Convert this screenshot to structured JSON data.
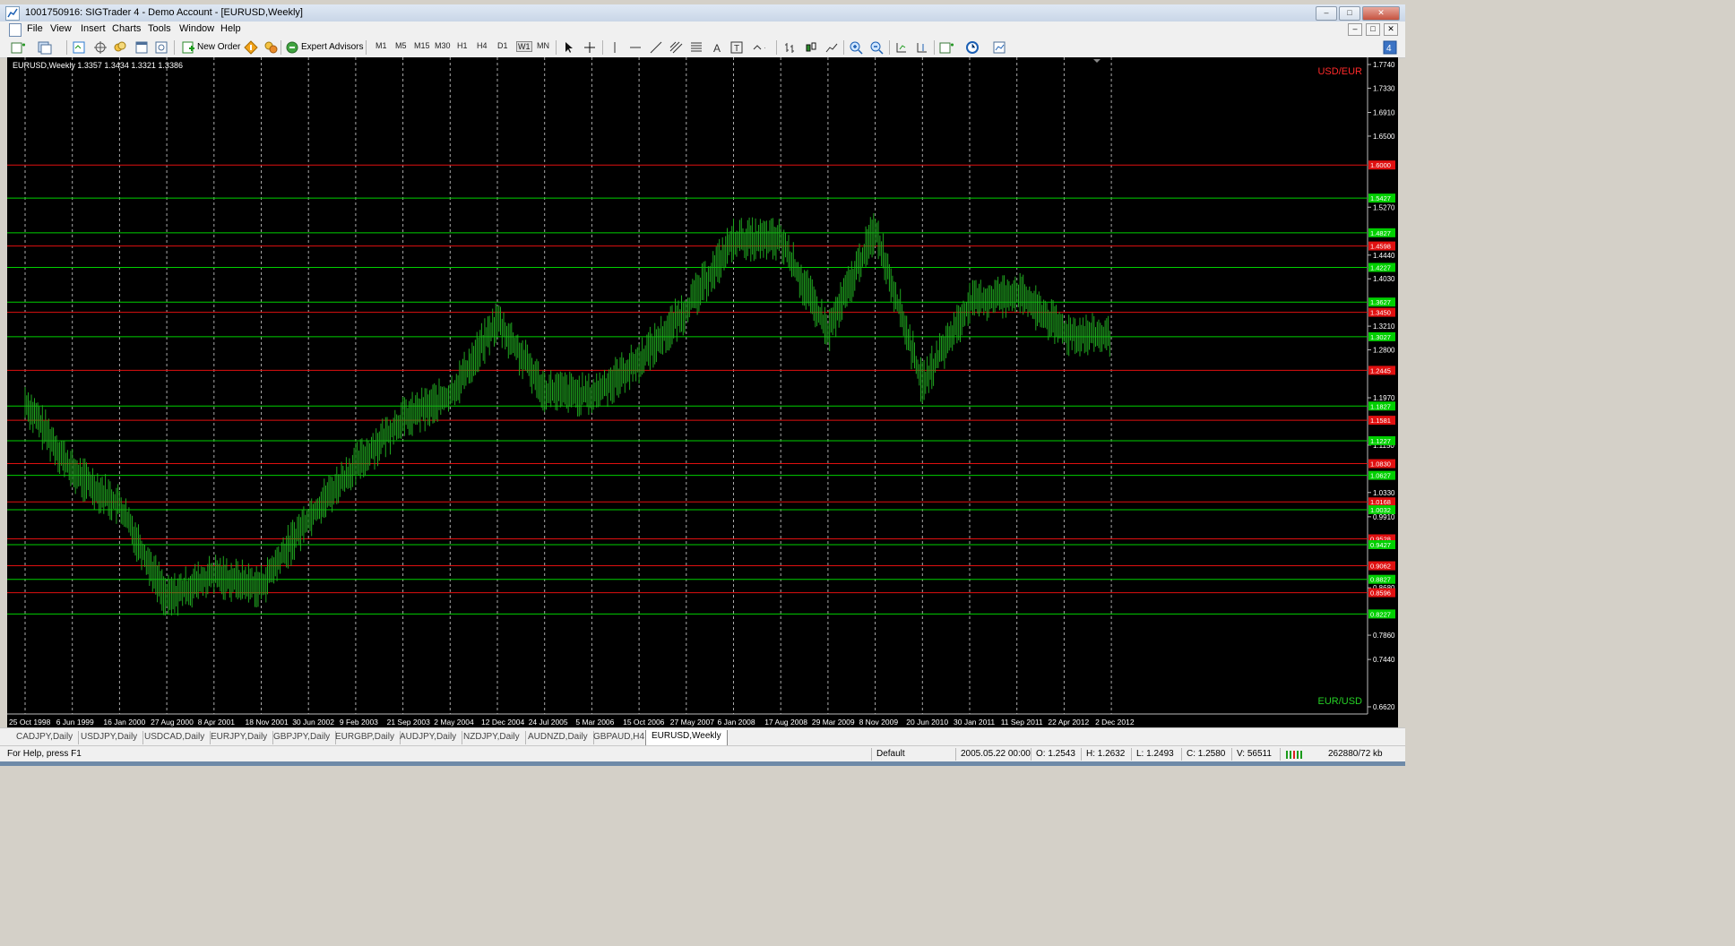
{
  "window": {
    "title": "1001750916: SIGTrader 4 - Demo Account - [EURUSD,Weekly]"
  },
  "menu": {
    "items": [
      "File",
      "View",
      "Insert",
      "Charts",
      "Tools",
      "Window",
      "Help"
    ]
  },
  "toolbar": {
    "new_order": "New Order",
    "expert_advisors": "Expert Advisors",
    "timeframes": [
      "M1",
      "M5",
      "M15",
      "M30",
      "H1",
      "H4",
      "D1",
      "W1",
      "MN"
    ],
    "active_timeframe": "W1"
  },
  "chart": {
    "header": "EURUSD,Weekly  1.3357 1.3434 1.3321 1.3386",
    "corner_top": "USD/EUR",
    "corner_bottom": "EUR/USD",
    "colors": {
      "background": "#000000",
      "candles": "#1fa41f",
      "green_line": "#00d000",
      "red_line": "#e01010",
      "grid": "#c8c8c8"
    }
  },
  "chart_data": {
    "type": "line",
    "title": "",
    "x": [
      "25 Oct 1998",
      "6 Jun 1999",
      "16 Jan 2000",
      "27 Aug 2000",
      "8 Apr 2001",
      "18 Nov 2001",
      "30 Jun 2002",
      "9 Feb 2003",
      "21 Sep 2003",
      "2 May 2004",
      "12 Dec 2004",
      "24 Jul 2005",
      "5 Mar 2006",
      "15 Oct 2006",
      "27 May 2007",
      "6 Jan 2008",
      "17 Aug 2008",
      "29 Mar 2009",
      "8 Nov 2009",
      "20 Jun 2010",
      "30 Jan 2011",
      "11 Sep 2011",
      "22 Apr 2012",
      "2 Dec 2012"
    ],
    "y_ticks": [
      "1.7740",
      "1.7330",
      "1.6910",
      "1.6500",
      "1.5270",
      "1.4440",
      "1.4030",
      "1.3210",
      "1.2800",
      "1.1970",
      "1.1150",
      "1.0330",
      "0.9910",
      "0.8680",
      "0.7860",
      "0.7440",
      "0.6620"
    ],
    "ylim": [
      0.662,
      1.774
    ],
    "price_path": [
      {
        "x": "25 Oct 1998",
        "y": 1.19
      },
      {
        "x": "6 Jun 1999",
        "y": 1.07
      },
      {
        "x": "16 Jan 2000",
        "y": 1.01
      },
      {
        "x": "27 Aug 2000",
        "y": 0.85
      },
      {
        "x": "8 Apr 2001",
        "y": 0.89
      },
      {
        "x": "18 Nov 2001",
        "y": 0.87
      },
      {
        "x": "30 Jun 2002",
        "y": 0.99
      },
      {
        "x": "9 Feb 2003",
        "y": 1.08
      },
      {
        "x": "21 Sep 2003",
        "y": 1.16
      },
      {
        "x": "2 May 2004",
        "y": 1.2
      },
      {
        "x": "12 Dec 2004",
        "y": 1.33
      },
      {
        "x": "24 Jul 2005",
        "y": 1.21
      },
      {
        "x": "5 Mar 2006",
        "y": 1.2
      },
      {
        "x": "15 Oct 2006",
        "y": 1.26
      },
      {
        "x": "27 May 2007",
        "y": 1.35
      },
      {
        "x": "6 Jan 2008",
        "y": 1.47
      },
      {
        "x": "17 Aug 2008",
        "y": 1.47
      },
      {
        "x": "29 Mar 2009",
        "y": 1.31
      },
      {
        "x": "8 Nov 2009",
        "y": 1.49
      },
      {
        "x": "20 Jun 2010",
        "y": 1.22
      },
      {
        "x": "30 Jan 2011",
        "y": 1.36
      },
      {
        "x": "11 Sep 2011",
        "y": 1.38
      },
      {
        "x": "22 Apr 2012",
        "y": 1.31
      },
      {
        "x": "2 Dec 2012",
        "y": 1.3
      }
    ],
    "hlines": [
      {
        "label": "1.6000",
        "color": "red"
      },
      {
        "label": "1.5427",
        "color": "green"
      },
      {
        "label": "1.4827",
        "color": "green"
      },
      {
        "label": "1.4598",
        "color": "red"
      },
      {
        "label": "1.4227",
        "color": "green"
      },
      {
        "label": "1.3627",
        "color": "green"
      },
      {
        "label": "1.3450",
        "color": "red"
      },
      {
        "label": "1.3027",
        "color": "green"
      },
      {
        "label": "1.2445",
        "color": "red"
      },
      {
        "label": "1.1827",
        "color": "green"
      },
      {
        "label": "1.1581",
        "color": "red"
      },
      {
        "label": "1.1227",
        "color": "green"
      },
      {
        "label": "1.0830",
        "color": "red"
      },
      {
        "label": "1.0627",
        "color": "green"
      },
      {
        "label": "1.0168",
        "color": "red"
      },
      {
        "label": "1.0032",
        "color": "green"
      },
      {
        "label": "0.9528",
        "color": "red"
      },
      {
        "label": "0.9427",
        "color": "green"
      },
      {
        "label": "0.9062",
        "color": "red"
      },
      {
        "label": "0.8827",
        "color": "green"
      },
      {
        "label": "0.8596",
        "color": "red"
      },
      {
        "label": "0.8227",
        "color": "green"
      }
    ]
  },
  "tabs": [
    "CADJPY,Daily",
    "USDJPY,Daily",
    "USDCAD,Daily",
    "EURJPY,Daily",
    "GBPJPY,Daily",
    "EURGBP,Daily",
    "AUDJPY,Daily",
    "NZDJPY,Daily",
    "AUDNZD,Daily",
    "GBPAUD,H4",
    "EURUSD,Weekly"
  ],
  "active_tab": "EURUSD,Weekly",
  "status": {
    "help": "For Help, press F1",
    "profile": "Default",
    "datetime": "2005.05.22 00:00",
    "open": "O: 1.2543",
    "high": "H: 1.2632",
    "low": "L: 1.2493",
    "close": "C: 1.2580",
    "volume": "V: 56511",
    "traffic": "262880/72 kb"
  }
}
